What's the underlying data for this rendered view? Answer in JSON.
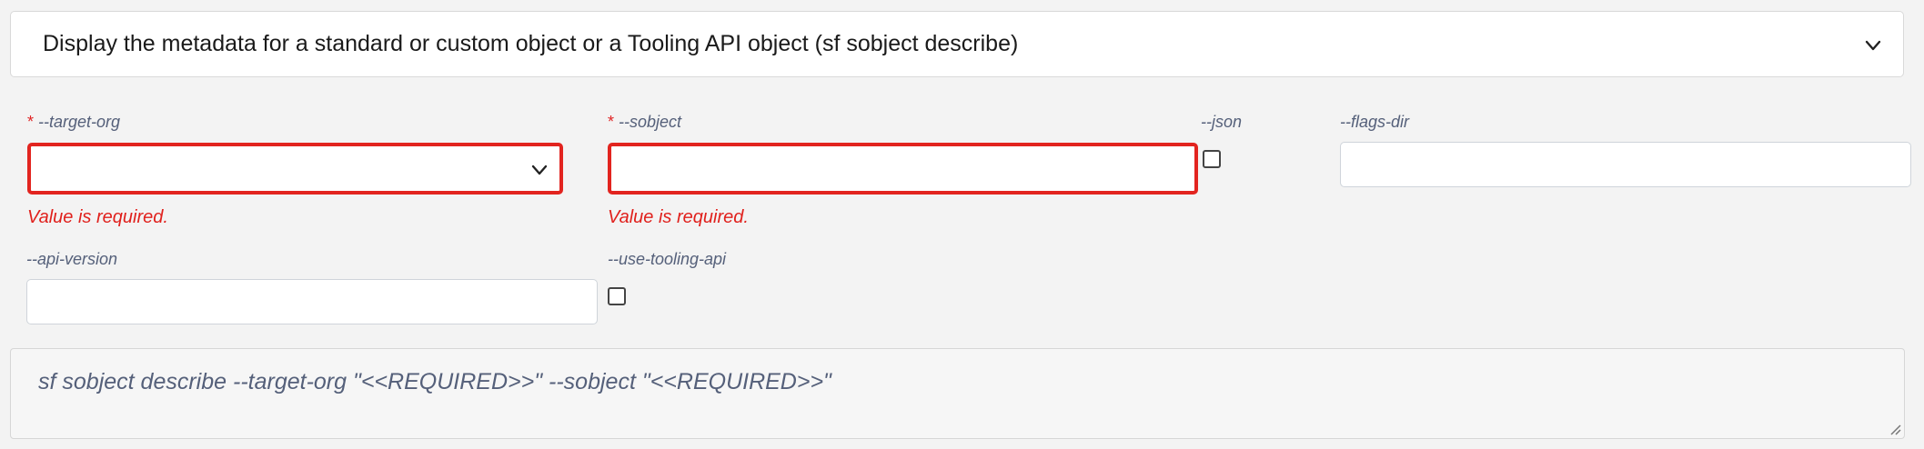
{
  "command": {
    "selected": "Display the metadata for a standard or custom object or a Tooling API object (sf sobject describe)",
    "icon": "chevron-down-icon"
  },
  "fields": {
    "target_org": {
      "required_marker": "*",
      "label": "--target-org",
      "value": "",
      "error": "Value is required."
    },
    "subject": {
      "required_marker": "*",
      "label": "--sobject",
      "value": "",
      "error": "Value is required."
    },
    "json": {
      "label": "--json",
      "checked": false
    },
    "flags_dir": {
      "label": "--flags-dir",
      "value": ""
    },
    "api_version": {
      "label": "--api-version",
      "value": ""
    },
    "use_tooling_api": {
      "label": "--use-tooling-api",
      "checked": false
    }
  },
  "preview": {
    "command_text": "sf sobject describe --target-org \"<<REQUIRED>>\" --sobject \"<<REQUIRED>>\""
  },
  "colors": {
    "error": "#e2241f",
    "label": "#55607a",
    "background": "#f3f3f3"
  }
}
